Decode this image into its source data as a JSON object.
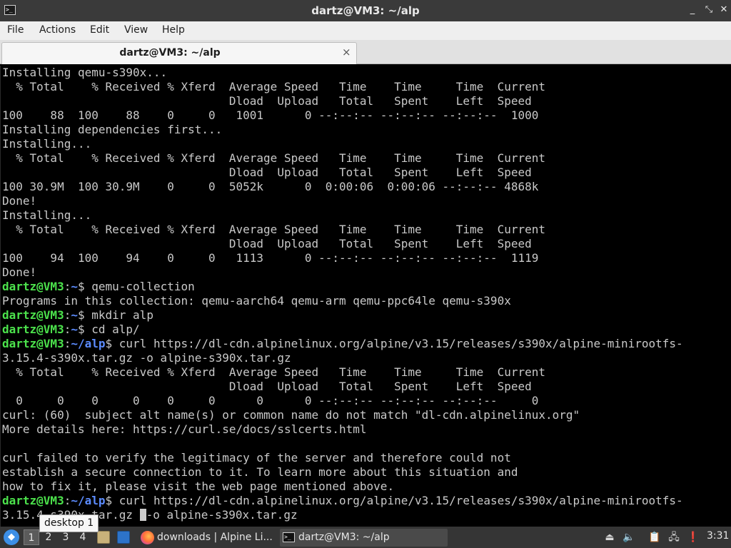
{
  "window": {
    "title": "dartz@VM3: ~/alp",
    "min_glyph": "_",
    "max_glyph": "⤡",
    "close_glyph": "✕"
  },
  "menu": {
    "file": "File",
    "actions": "Actions",
    "edit": "Edit",
    "view": "View",
    "help": "Help"
  },
  "tab": {
    "label": "dartz@VM3: ~/alp",
    "close_glyph": "×"
  },
  "terminal": {
    "colors": {
      "user": "#4ce24c",
      "path": "#5c8cff",
      "text": "#c9c9c9"
    },
    "lines": [
      {
        "text": "Installing qemu-s390x..."
      },
      {
        "text": "  % Total    % Received % Xferd  Average Speed   Time    Time     Time  Current"
      },
      {
        "text": "                                 Dload  Upload   Total   Spent    Left  Speed"
      },
      {
        "text": "100    88  100    88    0     0   1001      0 --:--:-- --:--:-- --:--:--  1000"
      },
      {
        "text": "Installing dependencies first..."
      },
      {
        "text": "Installing..."
      },
      {
        "text": "  % Total    % Received % Xferd  Average Speed   Time    Time     Time  Current"
      },
      {
        "text": "                                 Dload  Upload   Total   Spent    Left  Speed"
      },
      {
        "text": "100 30.9M  100 30.9M    0     0  5052k      0  0:00:06  0:00:06 --:--:-- 4868k"
      },
      {
        "text": "Done!"
      },
      {
        "text": "Installing..."
      },
      {
        "text": "  % Total    % Received % Xferd  Average Speed   Time    Time     Time  Current"
      },
      {
        "text": "                                 Dload  Upload   Total   Spent    Left  Speed"
      },
      {
        "text": "100    94  100    94    0     0   1113      0 --:--:-- --:--:-- --:--:--  1119"
      },
      {
        "text": "Done!"
      },
      {
        "user": "dartz@VM3",
        "path": "~",
        "cmd": "$ qemu-collection"
      },
      {
        "text": "Programs in this collection: qemu-aarch64 qemu-arm qemu-ppc64le qemu-s390x"
      },
      {
        "user": "dartz@VM3",
        "path": "~",
        "cmd": "$ mkdir alp"
      },
      {
        "user": "dartz@VM3",
        "path": "~",
        "cmd": "$ cd alp/"
      },
      {
        "user": "dartz@VM3",
        "path": "~/alp",
        "cmd": "$ curl https://dl-cdn.alpinelinux.org/alpine/v3.15/releases/s390x/alpine-minirootfs-"
      },
      {
        "text": "3.15.4-s390x.tar.gz -o alpine-s390x.tar.gz"
      },
      {
        "text": "  % Total    % Received % Xferd  Average Speed   Time    Time     Time  Current"
      },
      {
        "text": "                                 Dload  Upload   Total   Spent    Left  Speed"
      },
      {
        "text": "  0     0    0     0    0     0      0      0 --:--:-- --:--:-- --:--:--     0"
      },
      {
        "text": "curl: (60)  subject alt name(s) or common name do not match \"dl-cdn.alpinelinux.org\""
      },
      {
        "text": "More details here: https://curl.se/docs/sslcerts.html"
      },
      {
        "text": ""
      },
      {
        "text": "curl failed to verify the legitimacy of the server and therefore could not"
      },
      {
        "text": "establish a secure connection to it. To learn more about this situation and"
      },
      {
        "text": "how to fix it, please visit the web page mentioned above."
      },
      {
        "user": "dartz@VM3",
        "path": "~/alp",
        "cmd": "$ curl https://dl-cdn.alpinelinux.org/alpine/v3.15/releases/s390x/alpine-minirootfs-"
      },
      {
        "text": "3.15.4-s390x.tar.gz ",
        "cursor": true,
        "after": "-o alpine-s390x.tar.gz"
      }
    ]
  },
  "tooltip": {
    "text": "desktop 1"
  },
  "taskbar": {
    "desktops": [
      "1",
      "2",
      "3",
      "4"
    ],
    "active_desktop": "1",
    "tasks": [
      {
        "label": "downloads | Alpine Li...",
        "icon": "firefox-icon"
      },
      {
        "label": "dartz@VM3: ~/alp",
        "icon": "terminal-icon"
      }
    ],
    "tray_icons": [
      "eject-icon",
      "volume-icon",
      "clipboard-icon",
      "network-icon",
      "notification-icon"
    ],
    "clock": "3:31"
  }
}
